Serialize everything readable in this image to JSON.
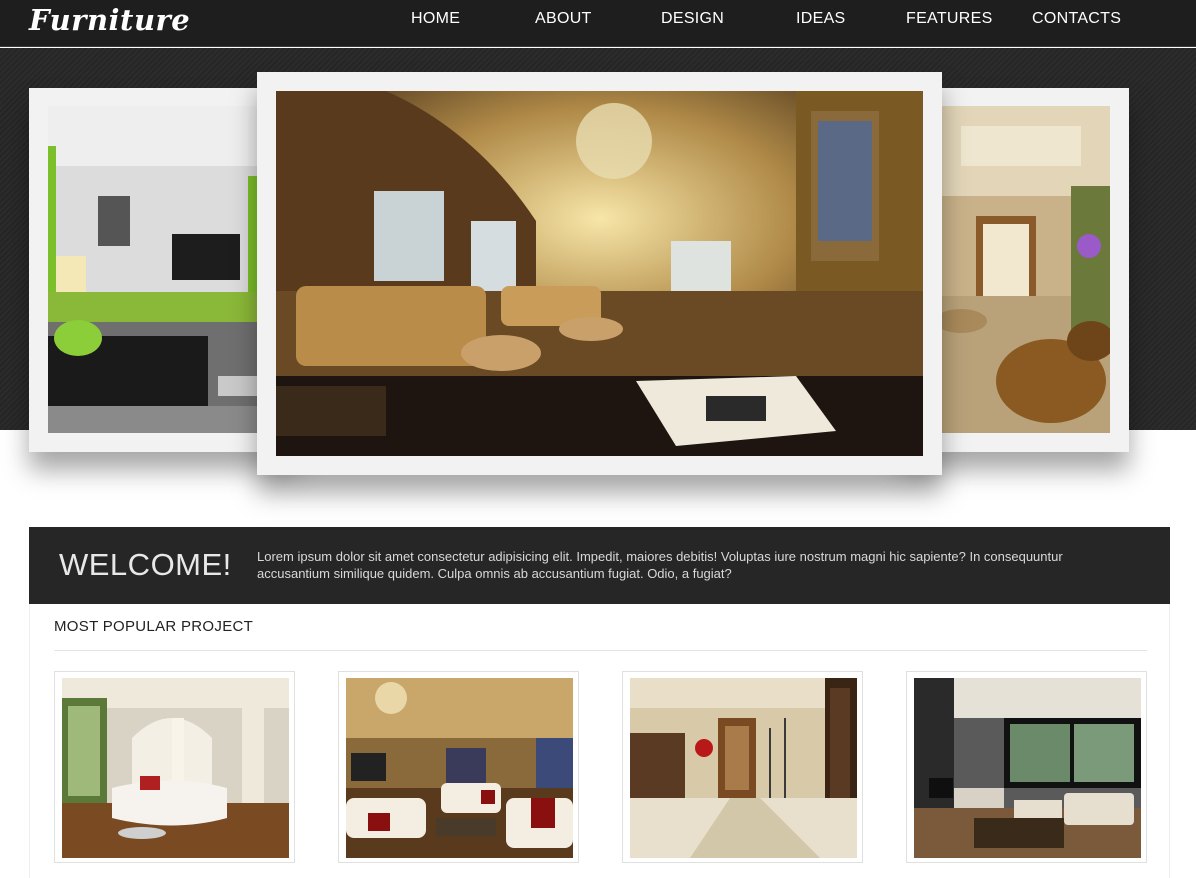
{
  "brand": {
    "logo": "Furniture"
  },
  "nav": {
    "items": [
      "HOME",
      "ABOUT",
      "DESIGN",
      "IDEAS",
      "FEATURES",
      "CONTACTS"
    ]
  },
  "colors": {
    "header_bg": "#1e1e1e",
    "hero_bg": "#2a2a2a",
    "welcome_bg": "#262626",
    "frame": "#f2f2f2"
  },
  "hero": {
    "slides": [
      "living-room-green-accent-photo",
      "luxury-lounge-chandelier-photo",
      "hotel-lobby-armchairs-photo"
    ]
  },
  "welcome": {
    "title": "WELCOME!",
    "text": "Lorem ipsum dolor sit amet consectetur adipisicing elit. Impedit, maiores debitis! Voluptas iure nostrum magni hic sapiente? In consequuntur accusantium similique quidem. Culpa omnis ab accusantium fugiat. Odio, a fugiat?"
  },
  "projects": {
    "title": "MOST POPULAR PROJECT",
    "items": [
      "white-living-room-photo",
      "warm-lounge-red-pillows-photo",
      "hallway-wooden-door-photo",
      "modern-fireplace-room-photo"
    ]
  }
}
